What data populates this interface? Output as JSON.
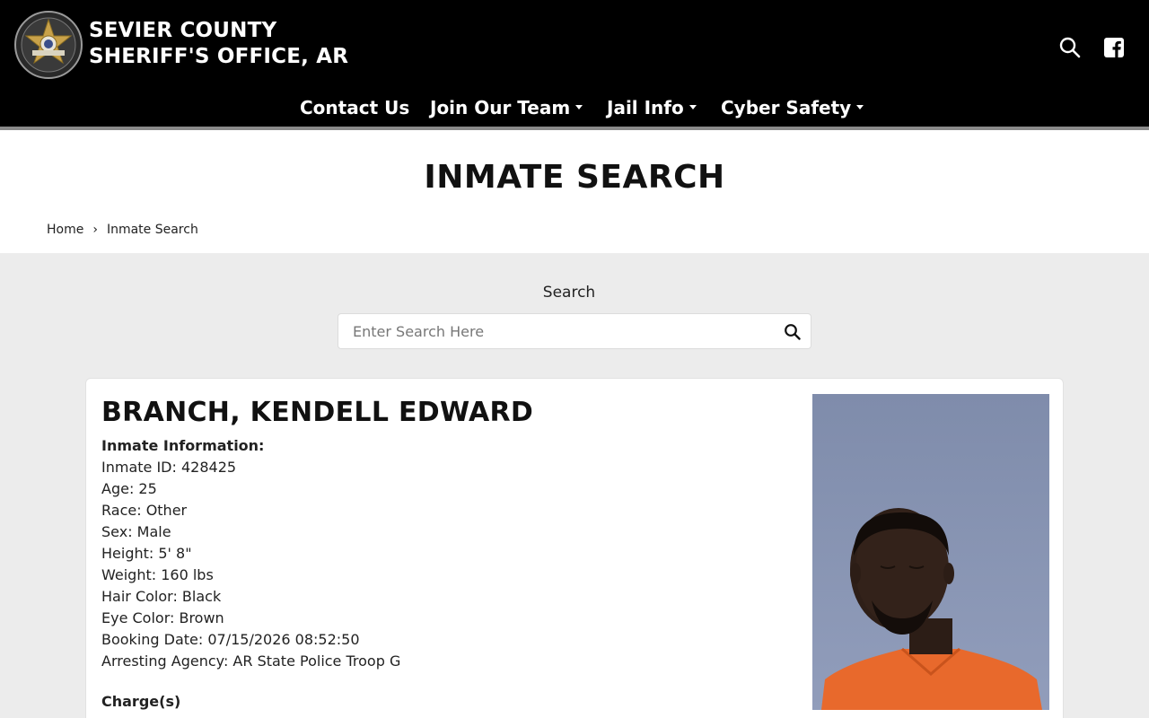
{
  "site": {
    "title_line1": "SEVIER COUNTY",
    "title_line2": "SHERIFF'S OFFICE, AR"
  },
  "nav": {
    "items": [
      {
        "label": "Contact Us",
        "has_dropdown": false
      },
      {
        "label": "Join Our Team",
        "has_dropdown": true
      },
      {
        "label": "Jail Info",
        "has_dropdown": true
      },
      {
        "label": "Cyber Safety",
        "has_dropdown": true
      }
    ]
  },
  "header_icons": [
    "search-icon",
    "facebook-icon"
  ],
  "page": {
    "title": "INMATE SEARCH",
    "breadcrumb": {
      "home": "Home",
      "separator": "›",
      "current": "Inmate Search"
    }
  },
  "search": {
    "label": "Search",
    "placeholder": "Enter Search Here",
    "value": ""
  },
  "inmate": {
    "name": "BRANCH, KENDELL EDWARD",
    "info_heading": "Inmate Information:",
    "fields": [
      "Inmate ID: 428425",
      "Age: 25",
      "Race: Other",
      "Sex: Male",
      "Height: 5' 8\"",
      "Weight: 160 lbs",
      "Hair Color: Black",
      "Eye Color: Brown",
      "Booking Date: 07/15/2026 08:52:50",
      "Arresting Agency: AR State Police Troop G"
    ],
    "charges_heading": "Charge(s)"
  },
  "colors": {
    "header_bg": "#000000",
    "page_bg": "#ececec",
    "photo_bg": "#8894b4",
    "shirt": "#e8692c"
  }
}
